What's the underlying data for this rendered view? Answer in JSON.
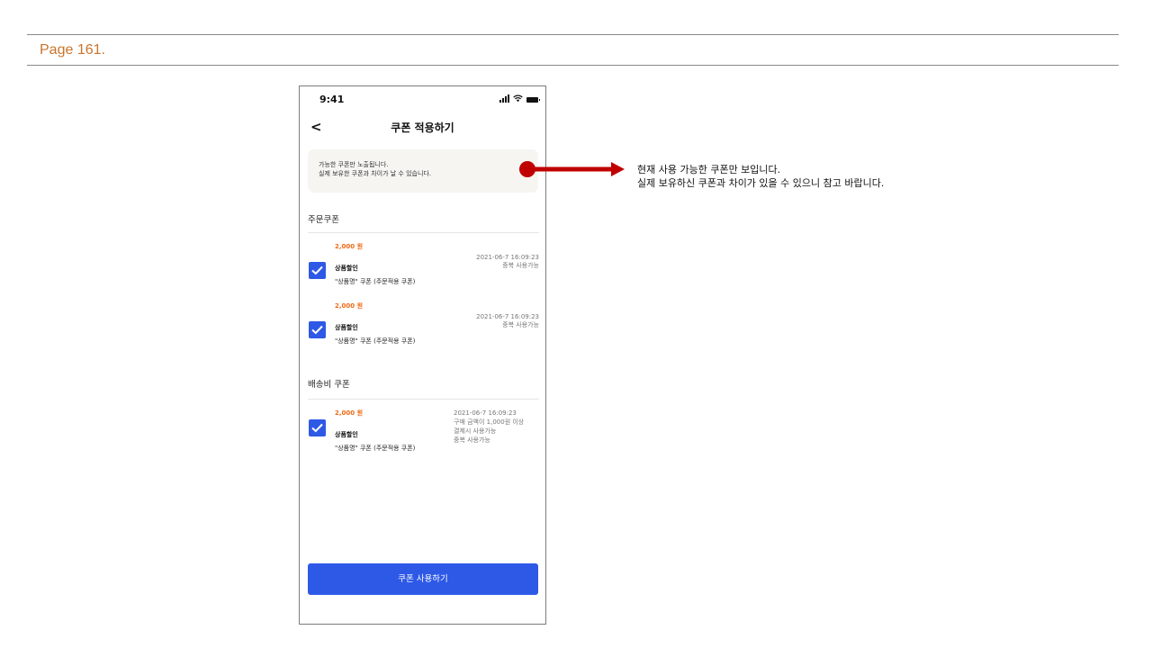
{
  "page_label": "Page 161.",
  "status": {
    "time": "9:41"
  },
  "header": {
    "back": "<",
    "title": "쿠폰 적용하기"
  },
  "notice": {
    "line1": "가능한 쿠폰만 노출됩니다.",
    "line2": "실제 보유한 쿠폰과 차이가 날 수 있습니다."
  },
  "order_section": {
    "title": "주문쿠폰",
    "coupons": [
      {
        "amount": "2,000 원",
        "name": "상품할인",
        "desc": "\"상품명\" 쿠폰 (주문적용 쿠폰)",
        "date": "2021-06-7 16:09:23",
        "note": "중복 사용가능",
        "checked": true
      },
      {
        "amount": "2,000 원",
        "name": "상품할인",
        "desc": "\"상품명\" 쿠폰 (주문적용 쿠폰)",
        "date": "2021-06-7 16:09:23",
        "note": "중복 사용가능",
        "checked": true
      }
    ]
  },
  "shipping_section": {
    "title": "배송비 쿠폰",
    "coupons": [
      {
        "amount": "2,000 원",
        "name": "상품할인",
        "desc": "\"상품명\" 쿠폰 (주문적용 쿠폰)",
        "date": "2021-06-7 16:09:23",
        "cond1": "구매 금액이 1,000원 이상",
        "cond2": "결제시 사용가능",
        "note": "중복 사용가능",
        "checked": true
      }
    ]
  },
  "button": {
    "label": "쿠폰 사용하기"
  },
  "annotation": {
    "line1": "현재 사용 가능한 쿠폰만 보입니다.",
    "line2": "실제 보유하신 쿠폰과 차이가 있을 수 있으니 참고 바랍니다."
  },
  "colors": {
    "accent_blue": "#2e59e6",
    "amount_orange": "#ef6a16",
    "arrow_red": "#c00000",
    "page_label": "#c8742c"
  }
}
